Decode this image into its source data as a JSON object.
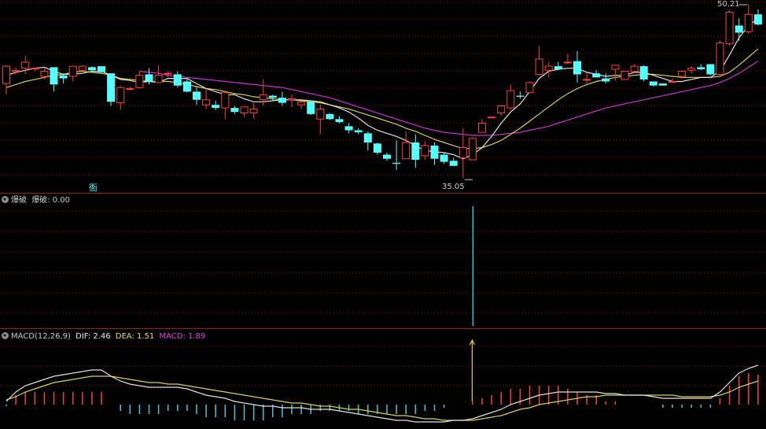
{
  "colors": {
    "up": "#ff3c3c",
    "down": "#54ffff",
    "ma_short": "#e0e0e0",
    "ma_mid": "#d8d33a",
    "ma_long": "#d12bd1",
    "grid": "#8b1010",
    "divider": "#a01818",
    "signal": "#3cc8d8",
    "arrow": "#e6c84a",
    "text": "#c8c8c8"
  },
  "main_panel": {
    "high_label": "50.21",
    "low_label": "35.05",
    "marker_char": "衙"
  },
  "indicator_panel": {
    "title": "爆破",
    "name": "爆破",
    "value_text": ": 0.00"
  },
  "macd_panel": {
    "title": "MACD(12,26,9)",
    "dif_label": "DIF: 2.46",
    "dea_label": "DEA: 1.51",
    "macd_label": "MACD: 1.89"
  },
  "chart_data": [
    {
      "type": "candlestick",
      "candles": [
        [
          44.4,
          46.2,
          43.3,
          46.1
        ],
        [
          45.6,
          46.0,
          45.3,
          45.7
        ],
        [
          45.9,
          47.1,
          45.3,
          46.5
        ],
        [
          45.9,
          46.0,
          45.6,
          45.9
        ],
        [
          45.1,
          46.0,
          44.8,
          45.6
        ],
        [
          46.0,
          46.0,
          43.6,
          44.3
        ],
        [
          45.2,
          45.4,
          44.4,
          44.9
        ],
        [
          45.1,
          46.1,
          44.6,
          46.1
        ],
        [
          45.7,
          46.2,
          45.6,
          46.1
        ],
        [
          46.0,
          46.1,
          45.5,
          45.7
        ],
        [
          46.1,
          46.1,
          45.4,
          45.5
        ],
        [
          45.4,
          45.4,
          42.2,
          42.6
        ],
        [
          42.5,
          44.2,
          41.8,
          44.0
        ],
        [
          43.9,
          44.1,
          43.7,
          43.9
        ],
        [
          44.0,
          45.6,
          43.9,
          45.2
        ],
        [
          45.3,
          45.9,
          44.3,
          44.6
        ],
        [
          44.5,
          46.2,
          44.5,
          45.2
        ],
        [
          45.4,
          45.6,
          45.0,
          45.4
        ],
        [
          45.3,
          45.6,
          44.0,
          44.2
        ],
        [
          44.6,
          44.9,
          43.5,
          43.6
        ],
        [
          43.6,
          44.1,
          42.3,
          42.8
        ],
        [
          42.3,
          43.9,
          41.9,
          42.8
        ],
        [
          42.3,
          42.7,
          41.8,
          42.0
        ],
        [
          42.0,
          43.7,
          40.9,
          43.5
        ],
        [
          42.0,
          42.2,
          41.4,
          41.6
        ],
        [
          41.5,
          42.1,
          41.1,
          42.1
        ],
        [
          41.5,
          42.5,
          41.0,
          41.9
        ],
        [
          42.8,
          44.8,
          42.2,
          43.3
        ],
        [
          43.2,
          43.3,
          42.7,
          43.0
        ],
        [
          43.0,
          43.6,
          42.2,
          42.5
        ],
        [
          42.8,
          43.3,
          42.1,
          42.9
        ],
        [
          42.3,
          42.7,
          41.9,
          42.6
        ],
        [
          42.6,
          42.6,
          41.3,
          41.4
        ],
        [
          40.9,
          42.3,
          39.4,
          41.9
        ],
        [
          41.4,
          41.5,
          40.8,
          40.9
        ],
        [
          40.9,
          41.2,
          40.5,
          40.6
        ],
        [
          40.2,
          40.5,
          39.5,
          39.8
        ],
        [
          39.8,
          40.0,
          39.4,
          39.6
        ],
        [
          39.5,
          39.7,
          37.8,
          38.6
        ],
        [
          38.5,
          38.6,
          37.4,
          37.6
        ],
        [
          37.4,
          37.6,
          36.8,
          37.0
        ],
        [
          36.6,
          38.8,
          35.9,
          36.5
        ],
        [
          37.0,
          39.7,
          37.0,
          38.6
        ],
        [
          38.6,
          39.4,
          36.1,
          36.9
        ],
        [
          37.3,
          38.7,
          36.9,
          38.3
        ],
        [
          38.3,
          38.6,
          36.4,
          37.0
        ],
        [
          37.4,
          37.6,
          36.5,
          36.7
        ],
        [
          36.8,
          37.1,
          36.3,
          36.3
        ],
        [
          37.1,
          40.0,
          35.1,
          38.1
        ],
        [
          36.9,
          39.1,
          36.9,
          39.0
        ],
        [
          39.6,
          40.9,
          39.6,
          40.5
        ],
        [
          41.1,
          41.1,
          41.1,
          41.1
        ],
        [
          41.5,
          42.3,
          41.2,
          42.2
        ],
        [
          42.0,
          44.3,
          41.8,
          43.7
        ],
        [
          43.2,
          43.6,
          42.9,
          43.1
        ],
        [
          43.5,
          44.6,
          43.5,
          44.5
        ],
        [
          45.3,
          48.1,
          45.3,
          46.8
        ],
        [
          45.7,
          46.5,
          45.0,
          46.1
        ],
        [
          46.1,
          46.5,
          45.7,
          45.8
        ],
        [
          46.5,
          47.3,
          46.3,
          46.5
        ],
        [
          46.6,
          47.6,
          44.5,
          45.3
        ],
        [
          44.8,
          45.4,
          44.4,
          44.8
        ],
        [
          45.4,
          45.7,
          45.0,
          45.0
        ],
        [
          44.9,
          45.4,
          44.4,
          44.6
        ],
        [
          45.8,
          46.2,
          44.7,
          46.2
        ],
        [
          44.8,
          45.6,
          44.8,
          45.6
        ],
        [
          45.6,
          46.3,
          45.4,
          46.1
        ],
        [
          46.1,
          46.2,
          44.6,
          44.8
        ],
        [
          44.6,
          44.6,
          44.1,
          44.2
        ],
        [
          44.4,
          44.4,
          44.2,
          44.2
        ],
        [
          44.6,
          44.9,
          44.6,
          44.6
        ],
        [
          45.1,
          45.7,
          44.9,
          45.6
        ],
        [
          45.7,
          46.1,
          45.4,
          45.9
        ],
        [
          46.0,
          46.3,
          45.7,
          45.8
        ],
        [
          46.3,
          46.3,
          45.2,
          45.3
        ],
        [
          45.3,
          48.6,
          45.2,
          48.4
        ],
        [
          48.3,
          51.6,
          48.1,
          51.4
        ],
        [
          50.1,
          50.8,
          48.6,
          49.4
        ],
        [
          49.5,
          52.2,
          49.3,
          51.2
        ],
        [
          51.2,
          51.7,
          50.1,
          50.2
        ]
      ],
      "ma_short": [
        [
          45.2,
          45.5,
          45.7,
          45.9,
          46.0,
          45.6,
          45.3,
          45.3,
          45.4,
          45.6,
          45.6,
          45.2,
          44.8,
          44.7,
          44.5,
          44.6,
          44.5,
          44.9,
          44.9,
          44.9,
          44.4,
          43.9,
          43.6,
          43.3,
          43.3,
          42.9,
          42.6,
          42.6,
          42.7,
          42.8,
          42.8,
          42.8,
          42.7,
          42.6,
          42.3,
          42.0,
          41.6,
          41.0,
          40.3,
          39.8,
          39.5,
          39.2,
          38.8,
          38.3,
          37.8,
          37.7,
          37.6,
          37.4,
          37.0,
          37.4,
          38.1,
          39.2,
          40.5,
          41.6,
          42.4,
          43.6,
          44.9,
          45.6,
          45.8,
          45.9,
          45.9,
          45.5,
          45.3,
          45.1,
          45.2,
          45.2,
          45.5,
          45.5,
          45.2,
          44.9,
          44.6,
          44.6,
          44.8,
          45.0,
          45.0,
          45.6,
          47.2,
          48.9,
          50.1,
          50.8
        ]
      ],
      "ma_mid": [
        [
          44.0,
          44.3,
          44.6,
          44.8,
          45.0,
          45.2,
          45.3,
          45.5,
          45.6,
          45.5,
          45.4,
          45.2,
          44.9,
          44.8,
          44.7,
          44.6,
          44.6,
          44.6,
          44.5,
          44.3,
          44.1,
          43.9,
          43.8,
          43.6,
          43.4,
          43.3,
          43.1,
          43.0,
          42.9,
          42.8,
          42.8,
          42.7,
          42.6,
          42.5,
          42.3,
          42.1,
          41.9,
          41.6,
          41.3,
          41.0,
          40.7,
          40.4,
          40.0,
          39.7,
          39.3,
          38.9,
          38.6,
          38.3,
          38.0,
          38.0,
          38.1,
          38.4,
          38.8,
          39.4,
          40.0,
          40.7,
          41.4,
          42.1,
          42.8,
          43.4,
          43.9,
          44.3,
          44.6,
          44.8,
          45.0,
          45.1,
          45.2,
          45.3,
          45.3,
          45.2,
          45.1,
          45.0,
          45.0,
          45.0,
          45.0,
          45.1,
          45.5,
          46.2,
          47.0,
          47.8
        ]
      ],
      "ma_long": [
        [
          null,
          null,
          null,
          null,
          null,
          null,
          null,
          null,
          null,
          null,
          null,
          null,
          null,
          null,
          45.6,
          45.5,
          45.4,
          45.2,
          45.1,
          45.0,
          44.9,
          44.8,
          44.7,
          44.6,
          44.5,
          44.4,
          44.3,
          44.2,
          44.1,
          44.0,
          43.8,
          43.6,
          43.4,
          43.2,
          43.0,
          42.7,
          42.4,
          42.1,
          41.8,
          41.5,
          41.2,
          40.9,
          40.6,
          40.3,
          40.0,
          39.8,
          39.6,
          39.5,
          39.4,
          39.3,
          39.3,
          39.3,
          39.4,
          39.5,
          39.6,
          39.8,
          40.0,
          40.2,
          40.5,
          40.8,
          41.1,
          41.4,
          41.7,
          42.0,
          42.2,
          42.4,
          42.6,
          42.8,
          43.0,
          43.2,
          43.4,
          43.6,
          43.8,
          44.0,
          44.2,
          44.5,
          44.9,
          45.4,
          46.0,
          46.6
        ]
      ]
    },
    {
      "type": "bar",
      "series": [
        {
          "name": "爆破",
          "values": [
            0,
            0,
            0,
            0,
            0,
            0,
            0,
            0,
            0,
            0,
            0,
            0,
            0,
            0,
            0,
            0,
            0,
            0,
            0,
            0,
            0,
            0,
            0,
            0,
            0,
            0,
            0,
            0,
            0,
            0,
            0,
            0,
            0,
            0,
            0,
            0,
            0,
            0,
            0,
            0,
            0,
            0,
            0,
            0,
            0,
            0,
            0,
            0,
            0,
            1,
            0,
            0,
            0,
            0,
            0,
            0,
            0,
            0,
            0,
            0,
            0,
            0,
            0,
            0,
            0,
            0,
            0,
            0,
            0,
            0,
            0,
            0,
            0,
            0,
            0,
            0,
            0,
            0,
            0,
            0
          ]
        }
      ]
    },
    {
      "type": "line",
      "dif": [
        0.2,
        0.8,
        1.2,
        1.4,
        1.6,
        1.8,
        1.9,
        2.0,
        2.1,
        2.2,
        2.2,
        1.8,
        1.5,
        1.3,
        1.2,
        1.1,
        1.1,
        1.1,
        1.1,
        1.0,
        0.8,
        0.6,
        0.5,
        0.4,
        0.2,
        0.1,
        0.0,
        -0.1,
        -0.1,
        -0.2,
        -0.2,
        -0.2,
        -0.3,
        -0.3,
        -0.3,
        -0.4,
        -0.5,
        -0.6,
        -0.7,
        -0.8,
        -0.9,
        -1.0,
        -1.0,
        -1.1,
        -1.1,
        -1.1,
        -1.1,
        -1.0,
        -1.0,
        -0.9,
        -0.7,
        -0.5,
        -0.3,
        0.0,
        0.2,
        0.4,
        0.6,
        0.7,
        0.8,
        0.8,
        0.8,
        0.8,
        0.8,
        0.7,
        0.7,
        0.6,
        0.6,
        0.6,
        0.5,
        0.4,
        0.4,
        0.4,
        0.4,
        0.4,
        0.4,
        0.8,
        1.4,
        2.0,
        2.3,
        2.5
      ],
      "dea": [
        0.3,
        0.5,
        0.8,
        1.0,
        1.2,
        1.4,
        1.5,
        1.6,
        1.7,
        1.8,
        1.8,
        1.8,
        1.7,
        1.6,
        1.5,
        1.4,
        1.4,
        1.3,
        1.3,
        1.2,
        1.1,
        1.0,
        0.9,
        0.8,
        0.7,
        0.6,
        0.5,
        0.4,
        0.3,
        0.2,
        0.1,
        0.1,
        0.0,
        -0.1,
        -0.1,
        -0.2,
        -0.3,
        -0.3,
        -0.4,
        -0.5,
        -0.6,
        -0.7,
        -0.7,
        -0.8,
        -0.9,
        -0.9,
        -1.0,
        -1.0,
        -1.0,
        -1.0,
        -0.9,
        -0.8,
        -0.7,
        -0.5,
        -0.3,
        -0.2,
        0.0,
        0.1,
        0.2,
        0.3,
        0.4,
        0.5,
        0.5,
        0.6,
        0.6,
        0.6,
        0.6,
        0.6,
        0.6,
        0.6,
        0.6,
        0.5,
        0.5,
        0.5,
        0.5,
        0.6,
        0.8,
        1.1,
        1.3,
        1.5
      ],
      "macd": [
        -0.1,
        0.6,
        0.8,
        0.8,
        0.8,
        0.8,
        0.8,
        0.8,
        0.8,
        0.8,
        0.8,
        0.0,
        -0.4,
        -0.6,
        -0.6,
        -0.6,
        -0.6,
        -0.4,
        -0.4,
        -0.4,
        -0.6,
        -0.8,
        -0.8,
        -0.8,
        -1.0,
        -1.0,
        -1.0,
        -1.0,
        -0.8,
        -0.8,
        -0.6,
        -0.6,
        -0.6,
        -0.4,
        -0.4,
        -0.4,
        -0.4,
        -0.6,
        -0.6,
        -0.6,
        -0.6,
        -0.6,
        -0.6,
        -0.6,
        -0.4,
        -0.4,
        -0.2,
        0.0,
        0.0,
        0.2,
        0.4,
        0.6,
        0.8,
        1.0,
        1.0,
        1.2,
        1.2,
        1.2,
        1.2,
        1.0,
        0.8,
        0.6,
        0.6,
        0.2,
        0.2,
        0.0,
        0.0,
        0.0,
        0.0,
        -0.2,
        -0.2,
        -0.2,
        -0.2,
        -0.2,
        -0.2,
        0.4,
        1.2,
        1.8,
        2.0,
        1.9
      ]
    }
  ]
}
